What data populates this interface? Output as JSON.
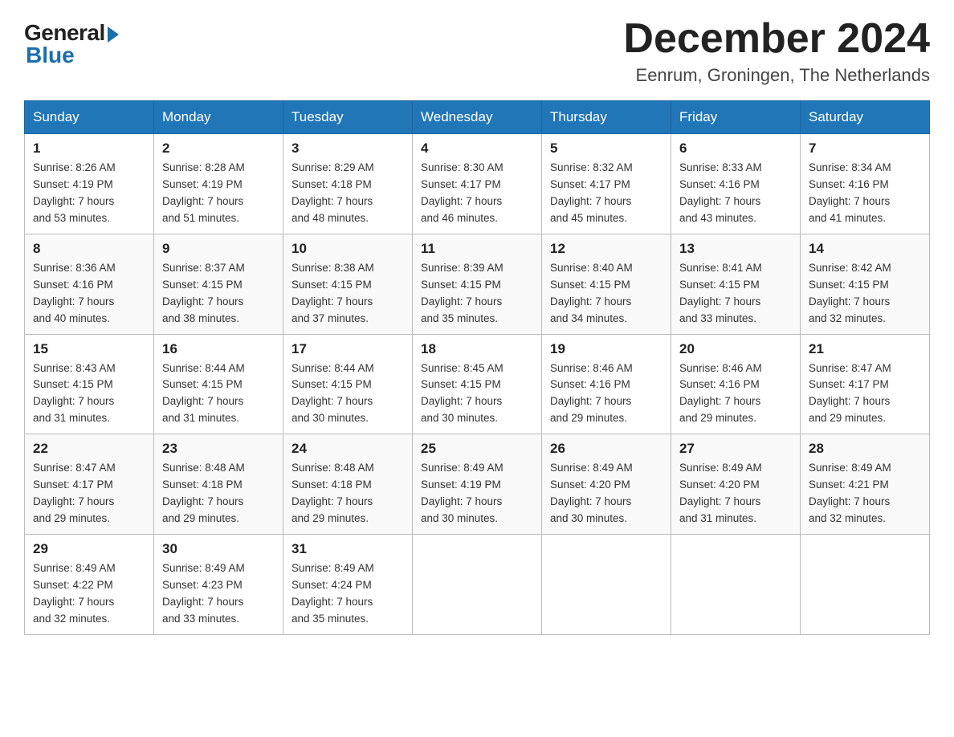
{
  "logo": {
    "general": "General",
    "blue": "Blue"
  },
  "header": {
    "month_year": "December 2024",
    "location": "Eenrum, Groningen, The Netherlands"
  },
  "weekdays": [
    "Sunday",
    "Monday",
    "Tuesday",
    "Wednesday",
    "Thursday",
    "Friday",
    "Saturday"
  ],
  "weeks": [
    [
      {
        "day": "1",
        "info": "Sunrise: 8:26 AM\nSunset: 4:19 PM\nDaylight: 7 hours\nand 53 minutes."
      },
      {
        "day": "2",
        "info": "Sunrise: 8:28 AM\nSunset: 4:19 PM\nDaylight: 7 hours\nand 51 minutes."
      },
      {
        "day": "3",
        "info": "Sunrise: 8:29 AM\nSunset: 4:18 PM\nDaylight: 7 hours\nand 48 minutes."
      },
      {
        "day": "4",
        "info": "Sunrise: 8:30 AM\nSunset: 4:17 PM\nDaylight: 7 hours\nand 46 minutes."
      },
      {
        "day": "5",
        "info": "Sunrise: 8:32 AM\nSunset: 4:17 PM\nDaylight: 7 hours\nand 45 minutes."
      },
      {
        "day": "6",
        "info": "Sunrise: 8:33 AM\nSunset: 4:16 PM\nDaylight: 7 hours\nand 43 minutes."
      },
      {
        "day": "7",
        "info": "Sunrise: 8:34 AM\nSunset: 4:16 PM\nDaylight: 7 hours\nand 41 minutes."
      }
    ],
    [
      {
        "day": "8",
        "info": "Sunrise: 8:36 AM\nSunset: 4:16 PM\nDaylight: 7 hours\nand 40 minutes."
      },
      {
        "day": "9",
        "info": "Sunrise: 8:37 AM\nSunset: 4:15 PM\nDaylight: 7 hours\nand 38 minutes."
      },
      {
        "day": "10",
        "info": "Sunrise: 8:38 AM\nSunset: 4:15 PM\nDaylight: 7 hours\nand 37 minutes."
      },
      {
        "day": "11",
        "info": "Sunrise: 8:39 AM\nSunset: 4:15 PM\nDaylight: 7 hours\nand 35 minutes."
      },
      {
        "day": "12",
        "info": "Sunrise: 8:40 AM\nSunset: 4:15 PM\nDaylight: 7 hours\nand 34 minutes."
      },
      {
        "day": "13",
        "info": "Sunrise: 8:41 AM\nSunset: 4:15 PM\nDaylight: 7 hours\nand 33 minutes."
      },
      {
        "day": "14",
        "info": "Sunrise: 8:42 AM\nSunset: 4:15 PM\nDaylight: 7 hours\nand 32 minutes."
      }
    ],
    [
      {
        "day": "15",
        "info": "Sunrise: 8:43 AM\nSunset: 4:15 PM\nDaylight: 7 hours\nand 31 minutes."
      },
      {
        "day": "16",
        "info": "Sunrise: 8:44 AM\nSunset: 4:15 PM\nDaylight: 7 hours\nand 31 minutes."
      },
      {
        "day": "17",
        "info": "Sunrise: 8:44 AM\nSunset: 4:15 PM\nDaylight: 7 hours\nand 30 minutes."
      },
      {
        "day": "18",
        "info": "Sunrise: 8:45 AM\nSunset: 4:15 PM\nDaylight: 7 hours\nand 30 minutes."
      },
      {
        "day": "19",
        "info": "Sunrise: 8:46 AM\nSunset: 4:16 PM\nDaylight: 7 hours\nand 29 minutes."
      },
      {
        "day": "20",
        "info": "Sunrise: 8:46 AM\nSunset: 4:16 PM\nDaylight: 7 hours\nand 29 minutes."
      },
      {
        "day": "21",
        "info": "Sunrise: 8:47 AM\nSunset: 4:17 PM\nDaylight: 7 hours\nand 29 minutes."
      }
    ],
    [
      {
        "day": "22",
        "info": "Sunrise: 8:47 AM\nSunset: 4:17 PM\nDaylight: 7 hours\nand 29 minutes."
      },
      {
        "day": "23",
        "info": "Sunrise: 8:48 AM\nSunset: 4:18 PM\nDaylight: 7 hours\nand 29 minutes."
      },
      {
        "day": "24",
        "info": "Sunrise: 8:48 AM\nSunset: 4:18 PM\nDaylight: 7 hours\nand 29 minutes."
      },
      {
        "day": "25",
        "info": "Sunrise: 8:49 AM\nSunset: 4:19 PM\nDaylight: 7 hours\nand 30 minutes."
      },
      {
        "day": "26",
        "info": "Sunrise: 8:49 AM\nSunset: 4:20 PM\nDaylight: 7 hours\nand 30 minutes."
      },
      {
        "day": "27",
        "info": "Sunrise: 8:49 AM\nSunset: 4:20 PM\nDaylight: 7 hours\nand 31 minutes."
      },
      {
        "day": "28",
        "info": "Sunrise: 8:49 AM\nSunset: 4:21 PM\nDaylight: 7 hours\nand 32 minutes."
      }
    ],
    [
      {
        "day": "29",
        "info": "Sunrise: 8:49 AM\nSunset: 4:22 PM\nDaylight: 7 hours\nand 32 minutes."
      },
      {
        "day": "30",
        "info": "Sunrise: 8:49 AM\nSunset: 4:23 PM\nDaylight: 7 hours\nand 33 minutes."
      },
      {
        "day": "31",
        "info": "Sunrise: 8:49 AM\nSunset: 4:24 PM\nDaylight: 7 hours\nand 35 minutes."
      },
      {
        "day": "",
        "info": ""
      },
      {
        "day": "",
        "info": ""
      },
      {
        "day": "",
        "info": ""
      },
      {
        "day": "",
        "info": ""
      }
    ]
  ]
}
